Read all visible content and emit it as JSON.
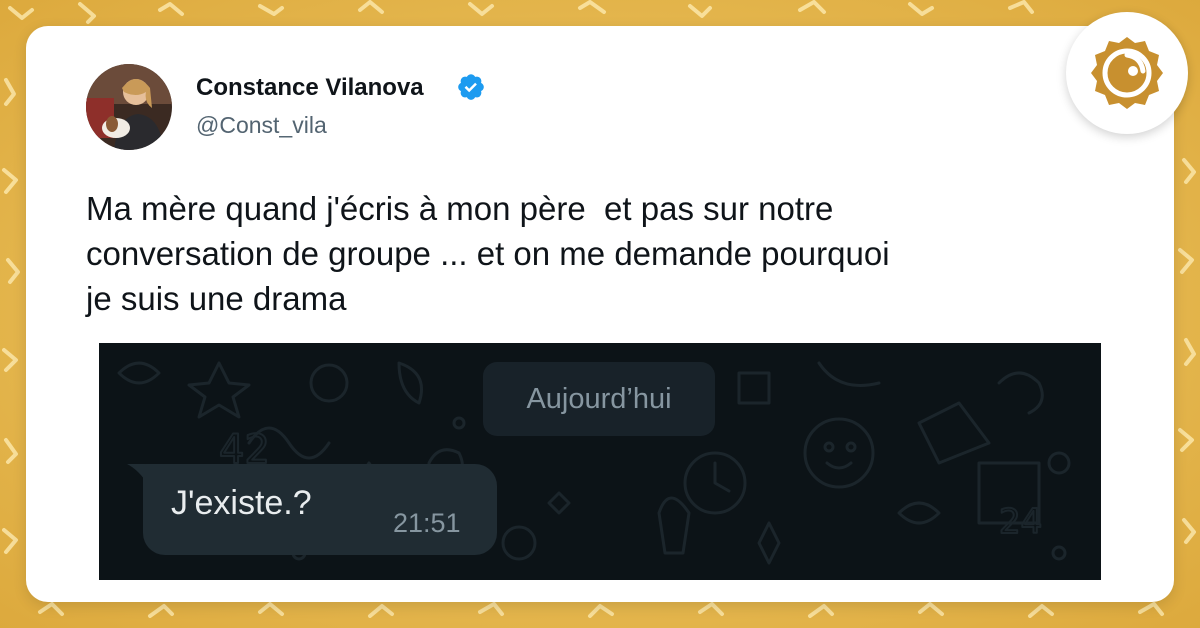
{
  "author": {
    "name": "Constance Vilanova",
    "handle": "@Const_vila",
    "verified": true
  },
  "tweet": {
    "text": "Ma mère quand j'écris à mon père  et pas sur notre\nconversation de groupe ... et on me demande pourquoi\nje suis une drama"
  },
  "chat": {
    "date_label": "Aujourd’hui",
    "message": {
      "text": "J'existe.?",
      "time": "21:51"
    }
  },
  "icons": {
    "verified": "verified-badge-icon",
    "brand": "brand-logo-icon"
  },
  "colors": {
    "background": "#e8b94a",
    "card": "#ffffff",
    "verified": "#1d9bf0",
    "chat_background": "#0c1317",
    "bubble": "#202c33",
    "brand": "#c8902f"
  }
}
